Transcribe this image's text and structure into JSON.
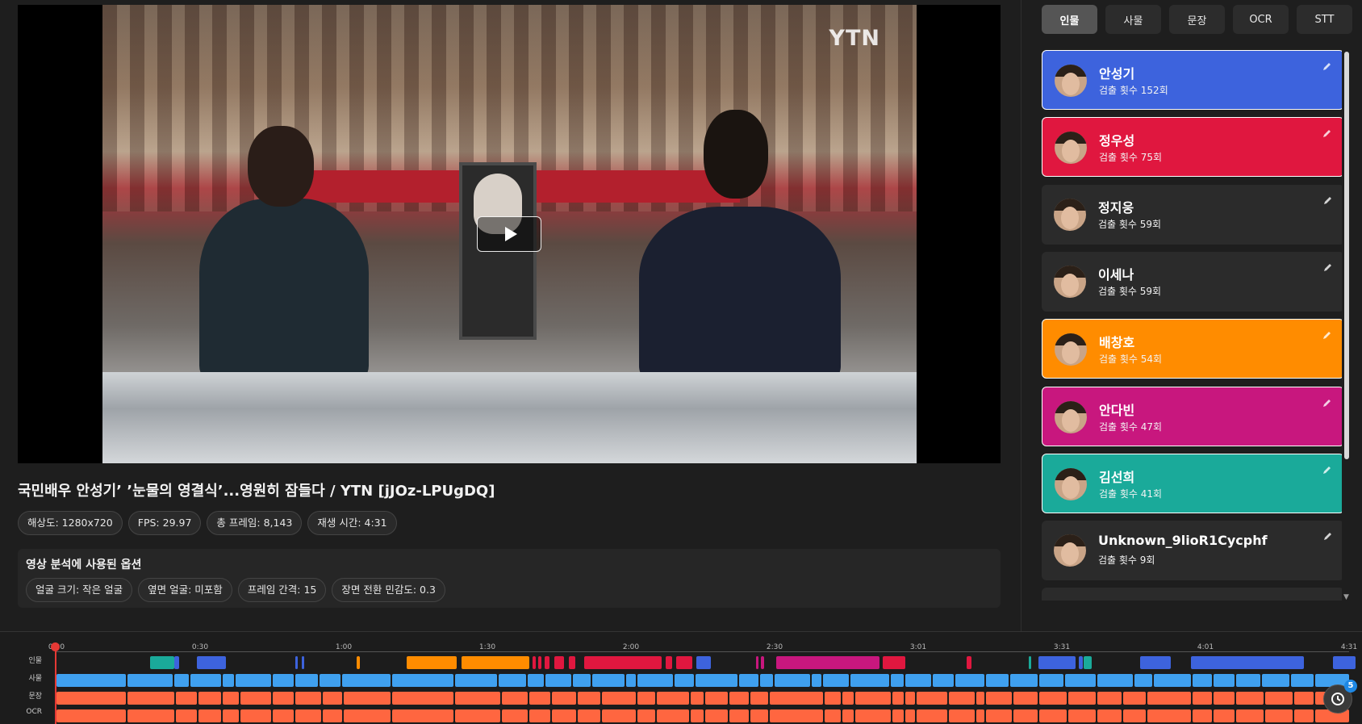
{
  "video": {
    "watermark": "YTN",
    "title": "국민배우 안성기’ ’눈물의 영결식’...영원히 잠들다 / YTN [jJOz-LPUgDQ]",
    "meta": [
      "해상도: 1280x720",
      "FPS: 29.97",
      "총 프레임: 8,143",
      "재생 시간: 4:31"
    ]
  },
  "options": {
    "title": "영상 분석에 사용된 옵션",
    "items": [
      "얼굴 크기: 작은 얼굴",
      "옆면 얼굴: 미포함",
      "프레임 간격: 15",
      "장면 전환 민감도: 0.3"
    ]
  },
  "tabs": [
    "인물",
    "사물",
    "문장",
    "OCR",
    "STT"
  ],
  "active_tab": "인물",
  "people": [
    {
      "name": "안성기",
      "count": "검출 횟수 152회",
      "color": "#3d63dd",
      "selected": true
    },
    {
      "name": "정우성",
      "count": "검출 횟수 75회",
      "color": "#e0173f",
      "selected": true
    },
    {
      "name": "정지웅",
      "count": "검출 횟수 59회",
      "color": "#2b2b2b",
      "selected": false
    },
    {
      "name": "이세나",
      "count": "검출 횟수 59회",
      "color": "#2b2b2b",
      "selected": false
    },
    {
      "name": "배창호",
      "count": "검출 횟수 54회",
      "color": "#ff8c00",
      "selected": true
    },
    {
      "name": "안다빈",
      "count": "검출 횟수 47회",
      "color": "#c8177e",
      "selected": true
    },
    {
      "name": "김선희",
      "count": "검출 횟수 41회",
      "color": "#1aaa9a",
      "selected": true
    },
    {
      "name": "Unknown_9lioR1Cycphf",
      "count": "검출 횟수 9회",
      "color": "#2b2b2b",
      "selected": false
    }
  ],
  "timeline": {
    "ticks": [
      "0:00",
      "0:30",
      "1:00",
      "1:30",
      "2:00",
      "2:30",
      "3:01",
      "3:31",
      "4:01",
      "4:31"
    ],
    "rows": [
      "인물",
      "사물",
      "문장",
      "OCR"
    ],
    "badge": "5",
    "colors": {
      "object": "#3fa0ef",
      "sentence": "#ff6640",
      "ocr": "#ff6640"
    }
  }
}
